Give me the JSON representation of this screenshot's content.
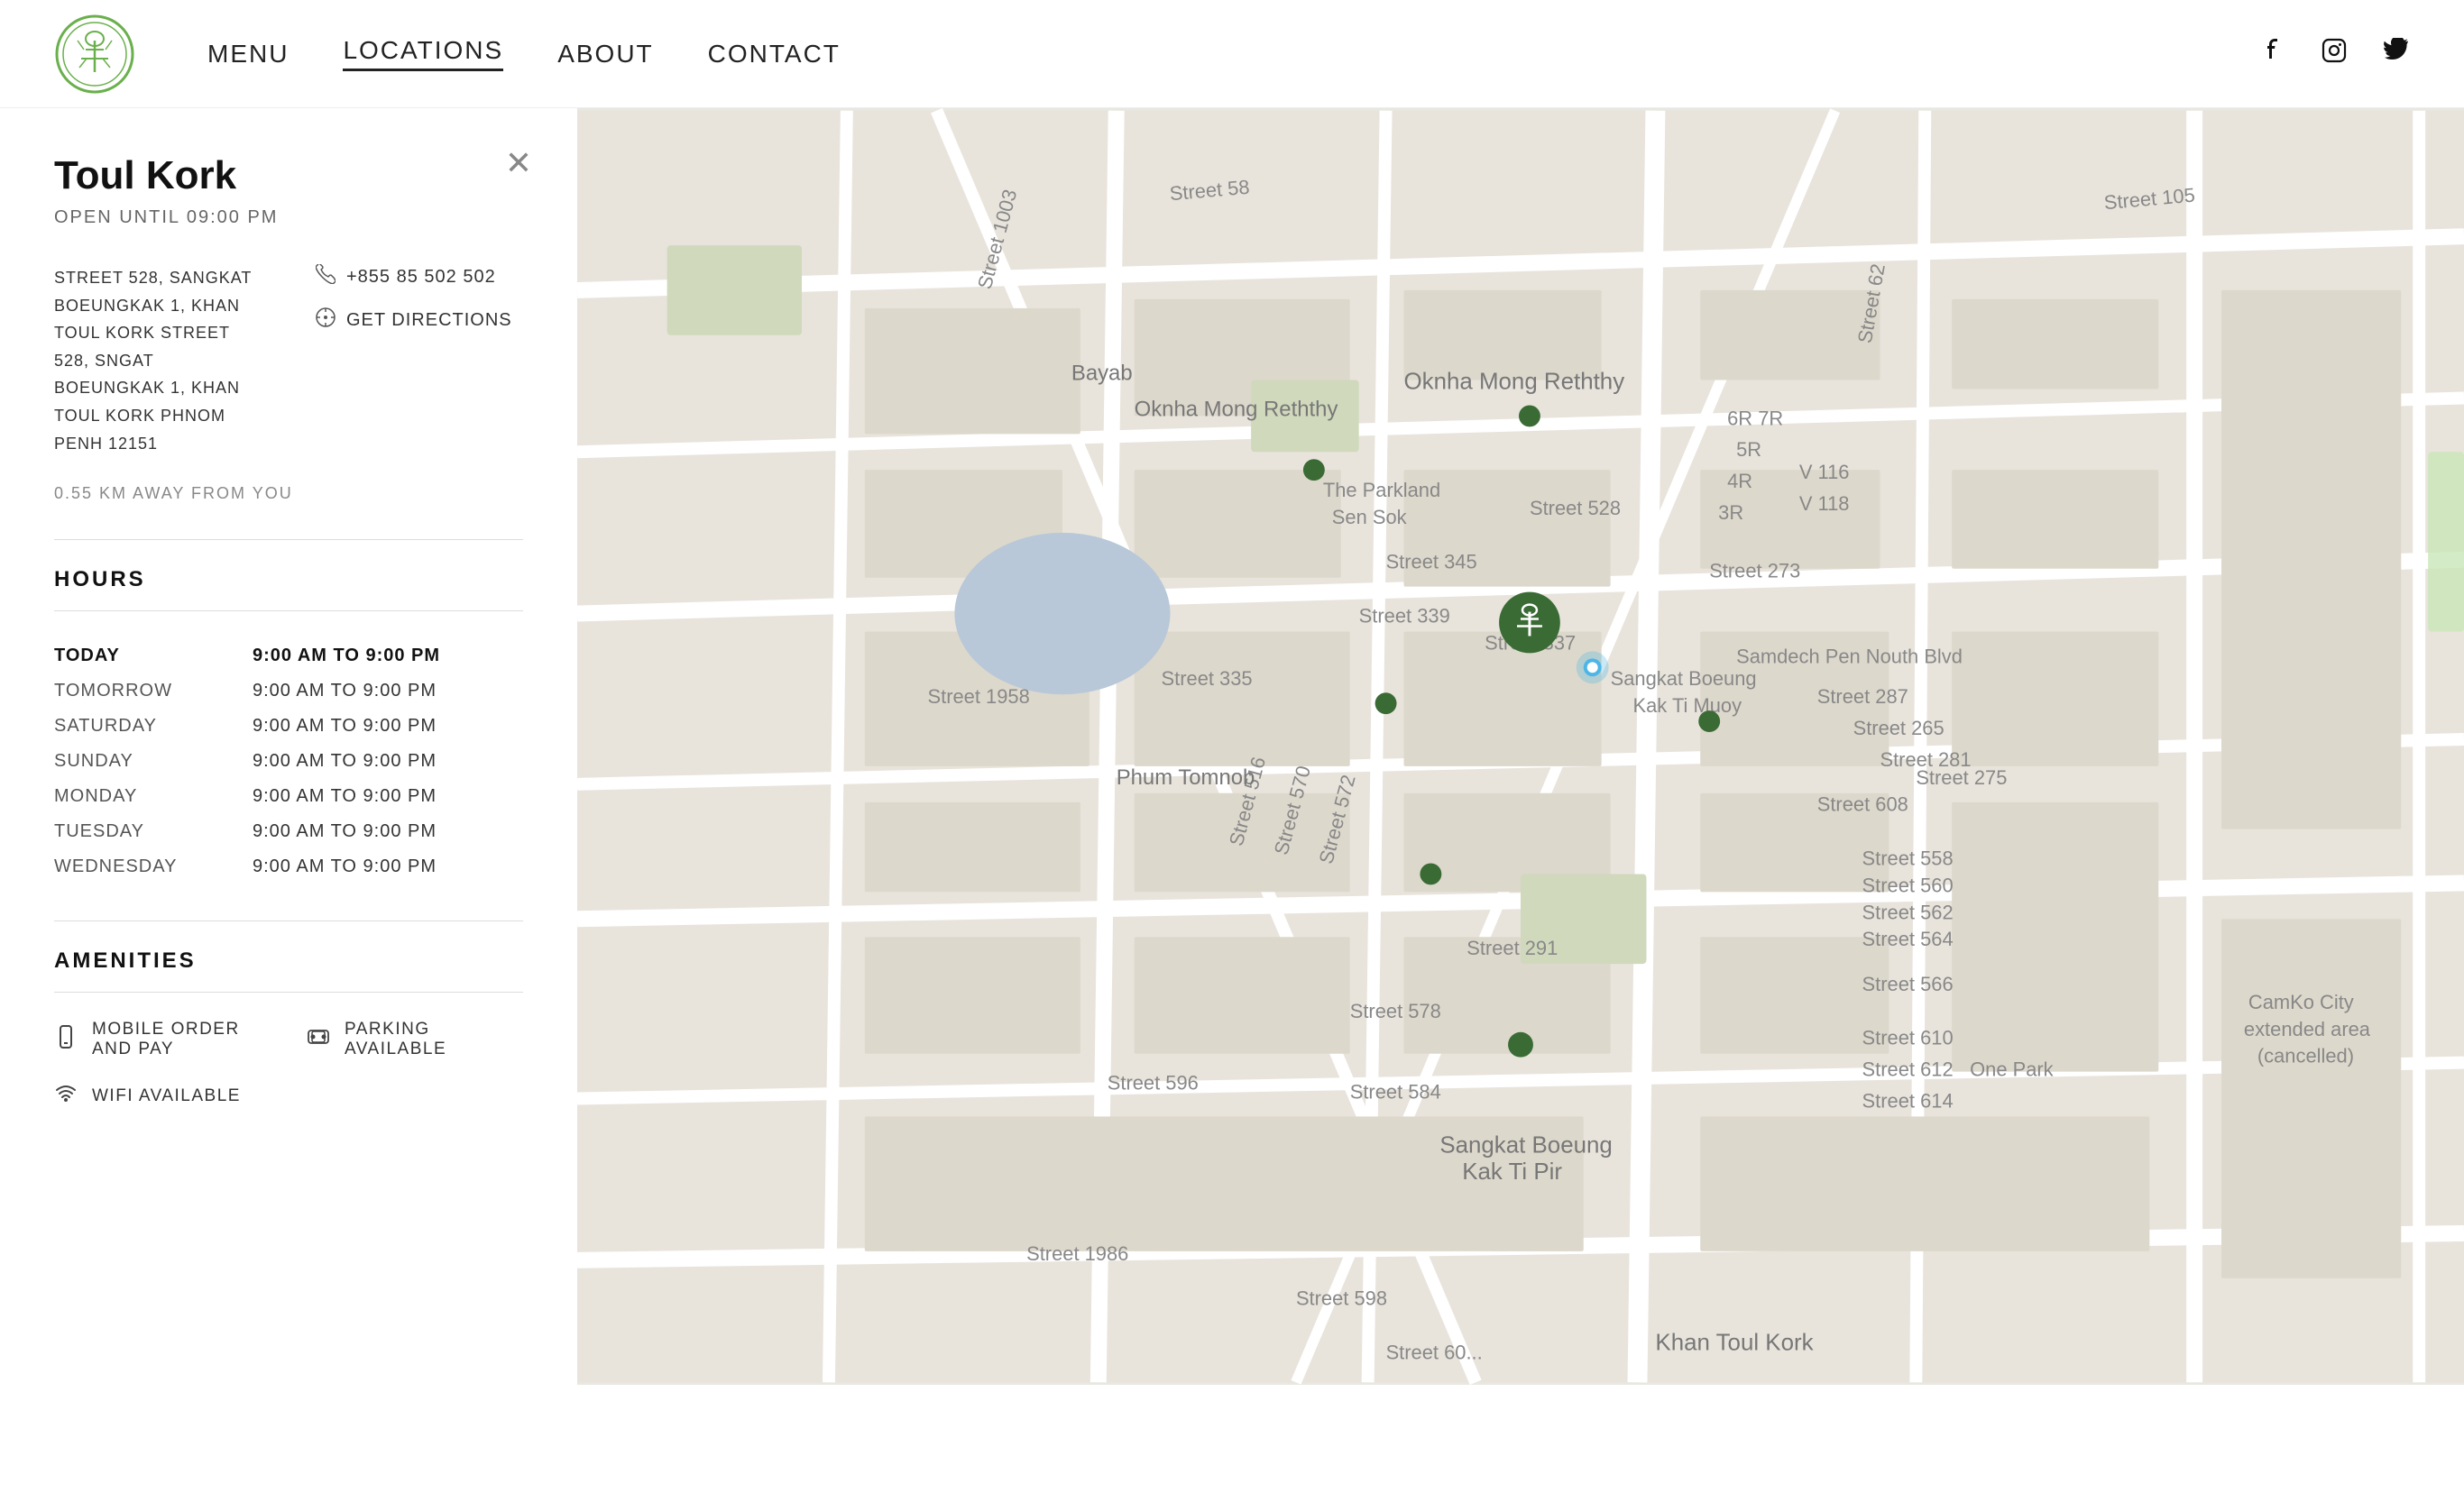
{
  "header": {
    "logo_alt": "Restaurant Logo",
    "nav": [
      {
        "label": "MENU",
        "href": "#",
        "active": false
      },
      {
        "label": "LOCATIONS",
        "href": "#",
        "active": true
      },
      {
        "label": "ABOUT",
        "href": "#",
        "active": false
      },
      {
        "label": "CONTACT",
        "href": "#",
        "active": false
      }
    ],
    "social": [
      {
        "name": "facebook",
        "icon": "f"
      },
      {
        "name": "instagram",
        "icon": "ig"
      },
      {
        "name": "twitter",
        "icon": "tw"
      }
    ]
  },
  "location": {
    "name": "Toul Kork",
    "status": "OPEN UNTIL 09:00 PM",
    "address": "STREET 528, SANGKAT BOEUNGKAK 1, KHAN TOUL KORK STREET 528, SNGAT BOEUNGKAK 1, KHAN TOUL KORK PHNOM PENH 12151",
    "phone": "+855 85 502 502",
    "get_directions": "GET DIRECTIONS",
    "distance": "0.55 KM AWAY FROM YOU"
  },
  "hours": {
    "title": "HOURS",
    "rows": [
      {
        "day": "TODAY",
        "hours": "9:00 AM to 9:00 PM",
        "today": true
      },
      {
        "day": "TOMORROW",
        "hours": "9:00 AM to 9:00 PM",
        "today": false
      },
      {
        "day": "SATURDAY",
        "hours": "9:00 AM to 9:00 PM",
        "today": false
      },
      {
        "day": "SUNDAY",
        "hours": "9:00 AM to 9:00 PM",
        "today": false
      },
      {
        "day": "MONDAY",
        "hours": "9:00 AM to 9:00 PM",
        "today": false
      },
      {
        "day": "TUESDAY",
        "hours": "9:00 AM to 9:00 PM",
        "today": false
      },
      {
        "day": "WEDNESDAY",
        "hours": "9:00 AM to 9:00 PM",
        "today": false
      }
    ]
  },
  "amenities": {
    "title": "AMENITIES",
    "items": [
      {
        "label": "MOBILE ORDER AND PAY",
        "icon": "mobile"
      },
      {
        "label": "PARKING AVAILABLE",
        "icon": "parking"
      },
      {
        "label": "WIFI AVAILABLE",
        "icon": "wifi"
      }
    ]
  },
  "map": {
    "bg_color": "#e8e4dc"
  }
}
